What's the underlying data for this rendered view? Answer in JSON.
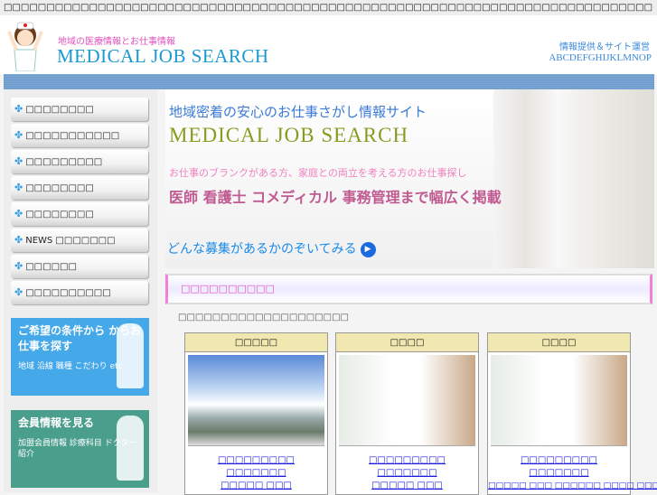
{
  "topbar": {
    "text": "□□□□□□□□□□□□□□□□□□□□□□□□□□□□□□□□□□□□□□□□□□□□□□□□□□□□□□□□□□□□□□□□□□□□□□□□□□□□"
  },
  "header": {
    "tagline": "地域の医療情報とお仕事情報",
    "logo": "MEDICAL  JOB SEARCH",
    "provider_label": "情報提供＆サイト運営",
    "provider_name": "ABCDEFGHIJKLMNOP"
  },
  "sidebar": {
    "items": [
      {
        "label": "□□□□□□□□"
      },
      {
        "label": "□□□□□□□□□□□"
      },
      {
        "label": "□□□□□□□□□"
      },
      {
        "label": "□□□□□□□□"
      },
      {
        "label": "□□□□□□□□"
      },
      {
        "label": "NEWS □□□□□□□"
      },
      {
        "label": "□□□□□□"
      },
      {
        "label": "□□□□□□□□□□"
      }
    ],
    "icon": "✤",
    "banners": [
      {
        "title": "ご希望の条件から からお仕事を探す",
        "sub": "地域 沿線 職種 こだわり etc",
        "color": "#45a8e8"
      },
      {
        "title": "会員情報を見る",
        "sub": "加盟会員情報 診療科目 ドクター紹介",
        "color": "#4a9e8c"
      }
    ]
  },
  "hero": {
    "line1": "地域密着の安心のお仕事さがし情報サイト",
    "line2": "MEDICAL JOB SEARCH",
    "line3": "お仕事のブランクがある方、家庭との両立を考える方のお仕事探し",
    "line4": "医師 看護士 コメディカル 事務管理まで幅広く掲載",
    "cta": "どんな募集があるかのぞいてみる",
    "cta_icon": "▶"
  },
  "section": {
    "heading": "□□□□□□□□□□",
    "intro": "□□□□□□□□□□□□□□□□□□□□"
  },
  "cards": [
    {
      "title": "□□□□□",
      "links": [
        "□□□□□□□□□",
        "□□□□□□□",
        "□□□□□ □□□"
      ]
    },
    {
      "title": "□□□□",
      "links": [
        "□□□□□□□□□",
        "□□□□□□□",
        "□□□□□ □□□"
      ]
    },
    {
      "title": "□□□□",
      "links": [
        "□□□□□□□□□",
        "□□□□□□□",
        "□□□□□ □□□ □□□□□□ □□□□ □□□"
      ]
    }
  ]
}
